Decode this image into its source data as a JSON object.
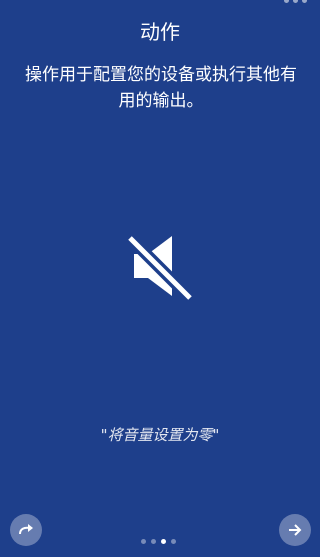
{
  "header": {
    "title": "动作",
    "description": "操作用于配置您的设备或执行其他有用的输出。"
  },
  "hero": {
    "icon": "volume-mute-icon"
  },
  "example": {
    "utterance": "\"将音量设置为零\""
  },
  "navigation": {
    "back_icon": "redo-arrow-icon",
    "next_icon": "arrow-right-icon",
    "page_count": 4,
    "current_page": 3
  },
  "colors": {
    "background": "#1e3f8b",
    "text": "#ffffff"
  }
}
